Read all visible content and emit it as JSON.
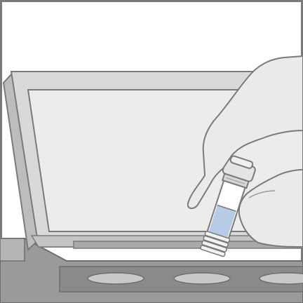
{
  "illustration": {
    "icons": {
      "frame": "frame-border",
      "device": "sample-block-device",
      "tube": "sample-tube",
      "hand": "gloved-hand"
    },
    "colors": {
      "outline": "#7a7a7a",
      "light_gray": "#dcdcdc",
      "mid_gray": "#c9c9c9",
      "dark_gray": "#a0a0a0",
      "screen": "#e8e8e8",
      "glove": "#eaeaea",
      "liquid": "#b7cbe6",
      "tube_body": "#ffffff",
      "base": "#8f8f8f"
    }
  }
}
